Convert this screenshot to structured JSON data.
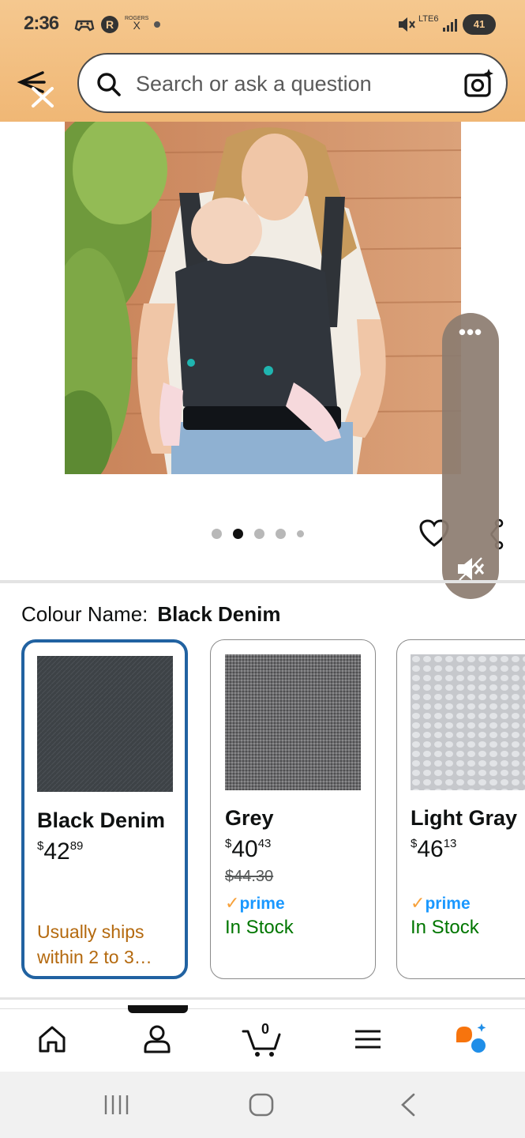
{
  "status_bar": {
    "time": "2:36",
    "carrier": "ROGERS",
    "carrier_sub": "X",
    "network": "LTE6",
    "battery": "41"
  },
  "search": {
    "placeholder": "Search or ask a question"
  },
  "gallery": {
    "image_count": 5,
    "active_index": 1
  },
  "colour": {
    "label": "Colour Name:",
    "selected": "Black Denim"
  },
  "swatches": [
    {
      "name": "Black Denim",
      "price_currency": "$",
      "price_whole": "42",
      "price_fraction": "89",
      "availability": "Usually ships within 2 to 3…",
      "swatch_color": "#3c4044"
    },
    {
      "name": "Grey",
      "price_currency": "$",
      "price_whole": "40",
      "price_fraction": "43",
      "list_price": "$44.30",
      "prime": "prime",
      "prime_check": "✓",
      "availability": "In Stock",
      "swatch_color": "#6e6e70"
    },
    {
      "name": "Light Gray",
      "price_currency": "$",
      "price_whole": "46",
      "price_fraction": "13",
      "prime": "prime",
      "prime_check": "✓",
      "availability": "In Stock",
      "swatch_color": "#cfd1d4"
    }
  ],
  "bottom_nav": {
    "cart_count": "0",
    "items": [
      "home-icon",
      "account-icon",
      "cart-icon",
      "menu-icon",
      "rufus-icon"
    ]
  },
  "colors": {
    "header": "#f0b775",
    "selected_border": "#2162a1",
    "prime_blue": "#1a98ff",
    "in_stock_green": "#007600",
    "ships_orange": "#b4690e"
  }
}
